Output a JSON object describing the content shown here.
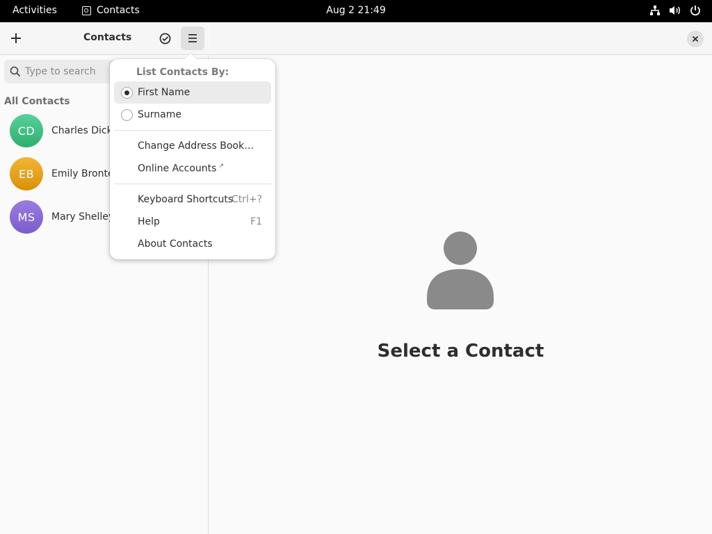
{
  "topbar": {
    "activities": "Activities",
    "app_name": "Contacts",
    "clock": "Aug 2  21:49",
    "tray_icons": [
      "network-icon",
      "volume-icon",
      "power-icon"
    ]
  },
  "sidebar": {
    "title": "Contacts",
    "search_placeholder": "Type to search",
    "section_label": "All Contacts",
    "contacts": [
      {
        "initials": "CD",
        "name": "Charles Dickens",
        "color": "#3fbf7f"
      },
      {
        "initials": "EB",
        "name": "Emily Bronte",
        "color": "#e5a50a"
      },
      {
        "initials": "MS",
        "name": "Mary Shelley",
        "color": "#8a6ad6"
      }
    ]
  },
  "main": {
    "empty_title": "Select a Contact"
  },
  "menu": {
    "heading": "List Contacts By:",
    "sort_options": [
      {
        "label": "First Name",
        "selected": true
      },
      {
        "label": "Surname",
        "selected": false
      }
    ],
    "change_address_book": "Change Address Book…",
    "online_accounts": "Online Accounts",
    "online_accounts_mark": "↗",
    "keyboard_shortcuts": "Keyboard Shortcuts",
    "keyboard_shortcuts_accel": "Ctrl+?",
    "help": "Help",
    "help_accel": "F1",
    "about": "About Contacts"
  },
  "colors": {
    "topbar_bg": "#000000",
    "popover_highlight": "#ebebeb",
    "placeholder_icon": "#8a8a8a"
  }
}
